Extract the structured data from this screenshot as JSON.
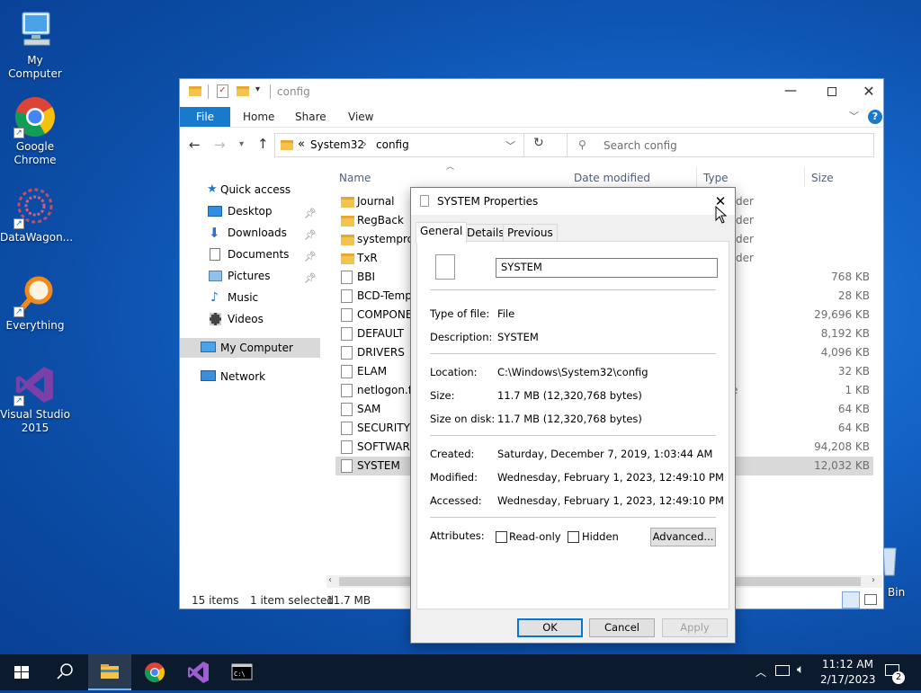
{
  "desktop": {
    "icons": [
      {
        "label": "My Computer"
      },
      {
        "label": "Google Chrome"
      },
      {
        "label": "DataWagon..."
      },
      {
        "label": "Everything"
      },
      {
        "label": "Visual Studio 2015"
      },
      {
        "label": "Bin"
      }
    ]
  },
  "explorer": {
    "title": "config",
    "tabs": {
      "file": "File",
      "home": "Home",
      "share": "Share",
      "view": "View"
    },
    "address": {
      "prefix": "«",
      "crumb1": "System32",
      "crumb2": "config"
    },
    "search_placeholder": "Search config",
    "columns": {
      "name": "Name",
      "date": "Date modified",
      "type": "Type",
      "size": "Size"
    },
    "nav": {
      "quick_access": "Quick access",
      "items": [
        {
          "label": "Desktop"
        },
        {
          "label": "Downloads"
        },
        {
          "label": "Documents"
        },
        {
          "label": "Pictures"
        },
        {
          "label": "Music"
        },
        {
          "label": "Videos"
        }
      ],
      "my_computer": "My Computer",
      "network": "Network"
    },
    "files": [
      {
        "name": "Journal",
        "type_partial": "der",
        "size": ""
      },
      {
        "name": "RegBack",
        "type_partial": "der",
        "size": ""
      },
      {
        "name": "systemprof",
        "type_partial": "der",
        "size": ""
      },
      {
        "name": "TxR",
        "type_partial": "der",
        "size": ""
      },
      {
        "name": "BBI",
        "type_partial": "",
        "size": "768 KB"
      },
      {
        "name": "BCD-Templ",
        "type_partial": "",
        "size": "28 KB"
      },
      {
        "name": "COMPONE",
        "type_partial": "",
        "size": "29,696 KB"
      },
      {
        "name": "DEFAULT",
        "type_partial": "",
        "size": "8,192 KB"
      },
      {
        "name": "DRIVERS",
        "type_partial": "",
        "size": "4,096 KB"
      },
      {
        "name": "ELAM",
        "type_partial": "",
        "size": "32 KB"
      },
      {
        "name": "netlogon.ft",
        "type_partial": "e",
        "size": "1 KB"
      },
      {
        "name": "SAM",
        "type_partial": "",
        "size": "64 KB"
      },
      {
        "name": "SECURITY",
        "type_partial": "",
        "size": "64 KB"
      },
      {
        "name": "SOFTWARE",
        "type_partial": "",
        "size": "94,208 KB"
      },
      {
        "name": "SYSTEM",
        "type_partial": "",
        "size": "12,032 KB"
      }
    ],
    "status": {
      "items": "15 items",
      "selected": "1 item selected",
      "size": "11.7 MB"
    }
  },
  "dialog": {
    "title": "SYSTEM Properties",
    "tabs": {
      "general": "General",
      "details": "Details",
      "previous": "Previous Versions"
    },
    "filename": "SYSTEM",
    "type_label": "Type of file:",
    "type_value": "File",
    "desc_label": "Description:",
    "desc_value": "SYSTEM",
    "location_label": "Location:",
    "location_value": "C:\\Windows\\System32\\config",
    "size_label": "Size:",
    "size_value": "11.7 MB (12,320,768 bytes)",
    "disk_label": "Size on disk:",
    "disk_value": "11.7 MB (12,320,768 bytes)",
    "created_label": "Created:",
    "created_value": "Saturday, December 7, 2019, 1:03:44 AM",
    "modified_label": "Modified:",
    "modified_value": "Wednesday, February 1, 2023, 12:49:10 PM",
    "accessed_label": "Accessed:",
    "accessed_value": "Wednesday, February 1, 2023, 12:49:10 PM",
    "attributes_label": "Attributes:",
    "readonly_label": "Read-only",
    "hidden_label": "Hidden",
    "advanced_label": "Advanced...",
    "ok_label": "OK",
    "cancel_label": "Cancel",
    "apply_label": "Apply"
  },
  "taskbar": {
    "time": "11:12 AM",
    "date": "2/17/2023",
    "notifications": "2"
  }
}
